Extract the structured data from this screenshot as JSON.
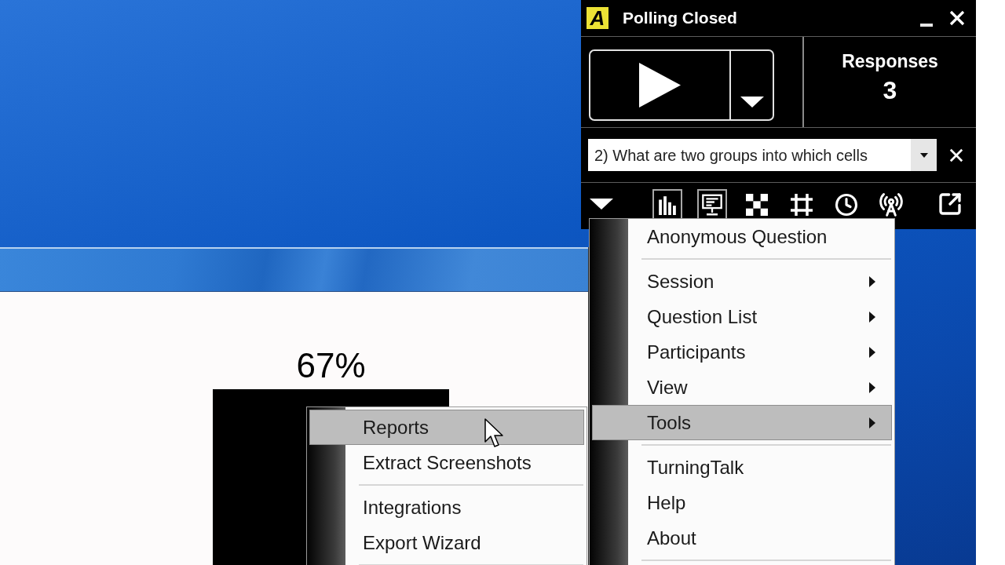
{
  "slide_window": {
    "bar_label": "67%"
  },
  "poll_panel": {
    "logo": "A",
    "title": "Polling Closed",
    "responses": {
      "label": "Responses",
      "count": "3"
    },
    "question_select": {
      "value": "2) What are two groups into which cells"
    },
    "toolbar": [
      {
        "on": true
      },
      {
        "on": true
      },
      {
        "on": false
      },
      {
        "on": false
      },
      {
        "on": false
      },
      {
        "on": false
      }
    ]
  },
  "menu": {
    "items": [
      {
        "kind": "item",
        "label": "Anonymous Question",
        "has_submenu": false,
        "selected": false
      },
      {
        "kind": "separator"
      },
      {
        "kind": "item",
        "label": "Session",
        "has_submenu": true,
        "selected": false
      },
      {
        "kind": "item",
        "label": "Question List",
        "has_submenu": true,
        "selected": false
      },
      {
        "kind": "item",
        "label": "Participants",
        "has_submenu": true,
        "selected": false
      },
      {
        "kind": "item",
        "label": "View",
        "has_submenu": true,
        "selected": false
      },
      {
        "kind": "item",
        "label": "Tools",
        "has_submenu": true,
        "selected": true
      },
      {
        "kind": "separator"
      },
      {
        "kind": "item",
        "label": "TurningTalk",
        "has_submenu": false,
        "selected": false
      },
      {
        "kind": "item",
        "label": "Help",
        "has_submenu": false,
        "selected": false
      },
      {
        "kind": "item",
        "label": "About",
        "has_submenu": false,
        "selected": false
      },
      {
        "kind": "separator"
      }
    ]
  },
  "submenu": {
    "items": [
      {
        "kind": "item",
        "label": "Reports",
        "has_submenu": false,
        "selected": true
      },
      {
        "kind": "item",
        "label": "Extract Screenshots",
        "has_submenu": false,
        "selected": false
      },
      {
        "kind": "separator"
      },
      {
        "kind": "item",
        "label": "Integrations",
        "has_submenu": false,
        "selected": false
      },
      {
        "kind": "item",
        "label": "Export Wizard",
        "has_submenu": false,
        "selected": false
      },
      {
        "kind": "separator"
      }
    ]
  }
}
